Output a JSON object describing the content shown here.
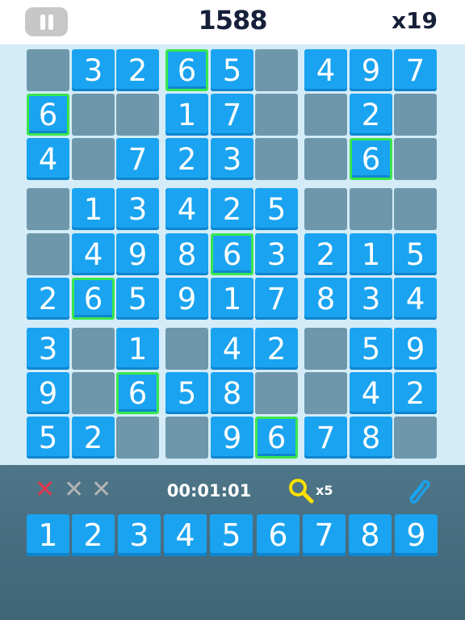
{
  "header": {
    "score": "1588",
    "multiplier": "x19"
  },
  "board": [
    [
      "",
      "3",
      "2",
      "6",
      "5",
      "",
      "4",
      "9",
      "7"
    ],
    [
      "6",
      "",
      "",
      "1",
      "7",
      "",
      "",
      "2",
      ""
    ],
    [
      "4",
      "",
      "7",
      "2",
      "3",
      "",
      "",
      "6",
      ""
    ],
    [
      "",
      "1",
      "3",
      "4",
      "2",
      "5",
      "",
      "",
      ""
    ],
    [
      "",
      "4",
      "9",
      "8",
      "6",
      "3",
      "2",
      "1",
      "5"
    ],
    [
      "2",
      "6",
      "5",
      "9",
      "1",
      "7",
      "8",
      "3",
      "4"
    ],
    [
      "3",
      "",
      "1",
      "",
      "4",
      "2",
      "",
      "5",
      "9"
    ],
    [
      "9",
      "",
      "6",
      "5",
      "8",
      "",
      "",
      "4",
      "2"
    ],
    [
      "5",
      "2",
      "",
      "",
      "9",
      "6",
      "7",
      "8",
      ""
    ]
  ],
  "highlighted_value": "6",
  "status": {
    "mistakes": [
      {
        "state": "used",
        "glyph": "✕",
        "color": "#e8354a"
      },
      {
        "state": "unused",
        "glyph": "✕",
        "color": "#b3b3b3"
      },
      {
        "state": "unused",
        "glyph": "✕",
        "color": "#b3b3b3"
      }
    ],
    "timer": "00:01:01",
    "hints": "x5",
    "hint_icon": "magnifier-icon",
    "note_icon": "paperclip-icon"
  },
  "numpad": [
    "1",
    "2",
    "3",
    "4",
    "5",
    "6",
    "7",
    "8",
    "9"
  ],
  "colors": {
    "tile": "#1aa3f0",
    "empty": "#6e97ab",
    "highlight": "#39e64e",
    "board_bg": "#d3ecf8",
    "panel": "#4e7688"
  }
}
